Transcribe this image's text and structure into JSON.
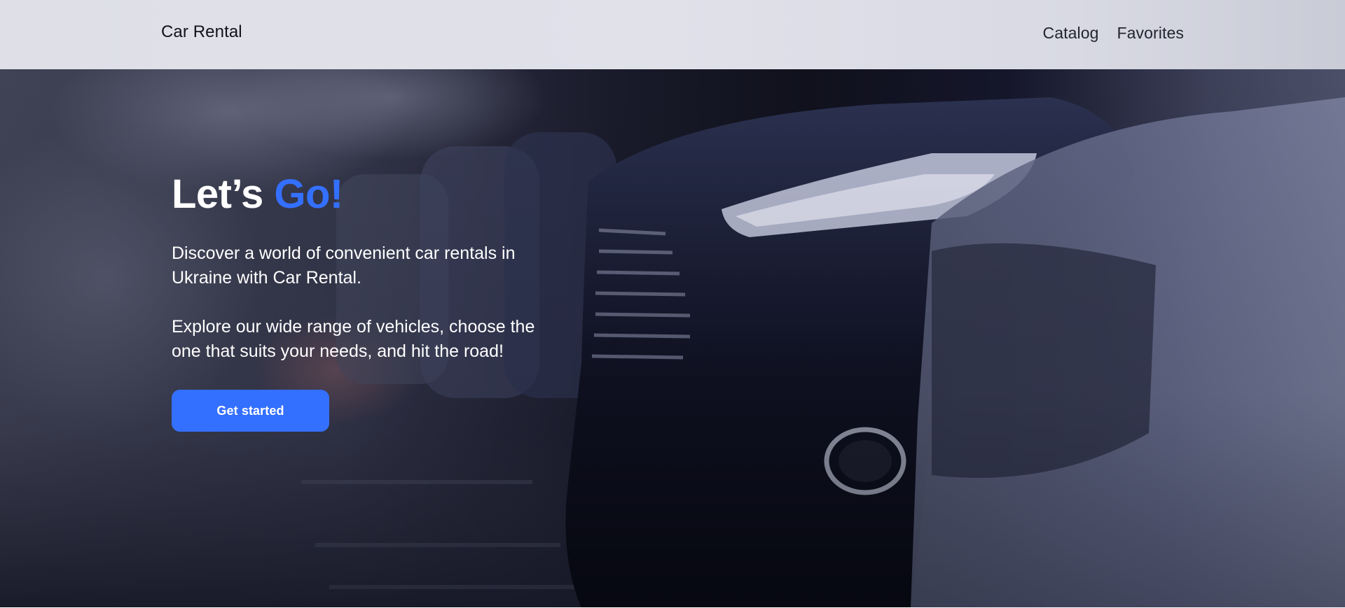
{
  "header": {
    "logo": "Car Rental",
    "nav": [
      {
        "label": "Catalog"
      },
      {
        "label": "Favorites"
      }
    ]
  },
  "hero": {
    "title_main": "Let’s ",
    "title_accent": "Go!",
    "paragraph_1": "Discover a world of convenient car rentals in Ukraine with Car Rental.",
    "paragraph_2": "Explore our wide range of vehicles, choose the one that suits your needs, and hit the road!",
    "cta_label": "Get started"
  },
  "colors": {
    "accent": "#3470FF",
    "header_bg": "#E0E1EA",
    "text_dark": "#121417"
  }
}
